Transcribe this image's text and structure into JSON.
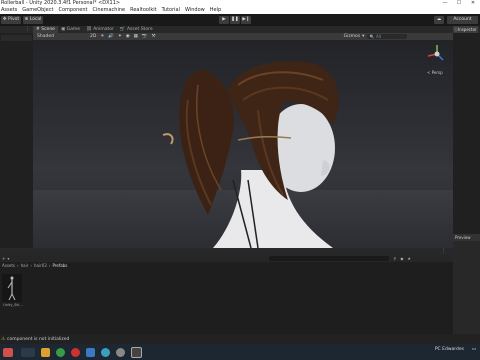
{
  "window": {
    "title": "Rollerball - Unity 2020.3.4f1 Personal* <DX11>",
    "controls": {
      "minimize": "—",
      "maximize": "☐",
      "close": "✕"
    }
  },
  "menu": {
    "items": [
      "Assets",
      "GameObject",
      "Component",
      "Cinemachine",
      "Realtoolkit",
      "Tutorial",
      "Window",
      "Help"
    ]
  },
  "toolbar": {
    "pivot": "Pivot",
    "local": "Local",
    "account": "Account"
  },
  "scene_tabs": {
    "scene": "Scene",
    "game": "Game",
    "animator": "Animator",
    "asset_store": "Asset Store"
  },
  "scene_toolbar": {
    "shading": "Shaded",
    "gizmos": "Gizmos",
    "search_placeholder": "All"
  },
  "gizmo": {
    "view_label": "< Persp"
  },
  "inspector": {
    "tab": "Inspector"
  },
  "preview": {
    "label": "Preview"
  },
  "project": {
    "breadcrumb": [
      "Assets",
      "hair",
      "hair03",
      "Prefabs"
    ],
    "asset_label": "Unity_Ski..."
  },
  "status": {
    "message": "component is not initialized"
  },
  "taskbar": {
    "user": "PC Edwardes"
  },
  "colors": {
    "titlebar_bg": "#ffffff",
    "editor_bg": "#191919",
    "panel_bg": "#202020",
    "active_tab": "#3c3c3c",
    "gizmo_red": "#e0403a",
    "gizmo_green": "#7ec04a",
    "gizmo_blue": "#3a78e0",
    "hair_brown": "#3b2214"
  }
}
